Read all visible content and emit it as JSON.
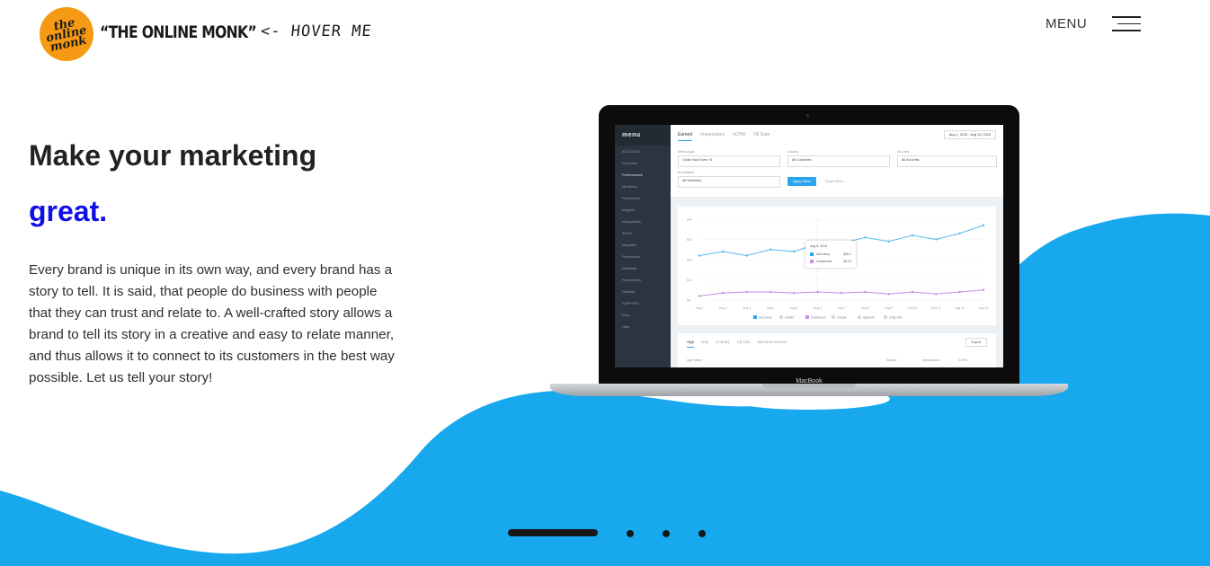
{
  "header": {
    "logo_text": "the\nonline\nmonk",
    "brand": "“THE ONLINE MONK”",
    "hover_hint": "<- HOVER ME",
    "menu_label": "MENU"
  },
  "hero": {
    "headline": "Make your marketing",
    "highlight": "great.",
    "description": "Every brand is unique in its own way, and every brand has a story to tell. It is said, that people do business with people that they can trust and relate to. A well-crafted story allows a brand to tell its story in a creative and easy to relate manner, and thus allows it to connect to its customers in the best way possible. Let us tell your story!"
  },
  "colors": {
    "accent_blue": "#1010e6",
    "wave_blue": "#17a8ee",
    "line_blue": "#5ab8ef",
    "line_purple": "#c48ee8"
  },
  "laptop": {
    "brand_label": "MacBook",
    "sidebar": {
      "title": "menu",
      "items": [
        "ACCOUNT",
        "Overview",
        "Performance",
        "Mediation",
        "Promotions",
        "Insights",
        "Integrations",
        "APPS",
        "Magnetic",
        "Promotions",
        "Materials",
        "Placements",
        "Settings",
        "SUPPORT",
        "Docs",
        "Help"
      ]
    },
    "tabs": [
      "Earned",
      "Impressions",
      "eCPM",
      "Fill Rate"
    ],
    "date_range": "Aug 1, 2016 - Aug 15, 2016",
    "filters": {
      "select_apps_label": "Select Apps",
      "select_apps_value": "Close Your Eyes +3",
      "country_label": "Country",
      "country_value": "All Countries",
      "ad_units_label": "Ad Units",
      "ad_units_value": "All Ad Units",
      "ad_network_label": "Ad Network",
      "ad_network_value": "All Networks",
      "apply_label": "Apply Filters",
      "reset_label": "Reset Filters"
    },
    "tooltip": {
      "date": "Aug 8, 2016",
      "rows": [
        {
          "name": "AdColony",
          "value": "$28.1"
        },
        {
          "name": "Chartboost",
          "value": "$3.24"
        }
      ]
    },
    "table": {
      "tabs": [
        "App",
        "Day",
        "Country",
        "Ad Unit",
        "Demand Source"
      ],
      "export_label": "Export",
      "headers": [
        "App Name",
        "Earned",
        "Impressions",
        "eCPM"
      ]
    }
  },
  "chart_data": {
    "type": "line",
    "title": "",
    "x": [
      "Aug 1",
      "Aug 2",
      "Aug 3",
      "Aug 4",
      "Aug 5",
      "Aug 6",
      "Aug 7",
      "Aug 8",
      "Aug 9",
      "Aug 10",
      "Aug 11",
      "Aug 12",
      "Aug 13"
    ],
    "y_ticks": [
      "$40",
      "$30",
      "$20",
      "$10",
      "$0"
    ],
    "ylim": [
      0,
      40
    ],
    "series": [
      {
        "name": "AdColony",
        "color": "#5ab8ef",
        "values": [
          22,
          24,
          22,
          25,
          24,
          28,
          28,
          31,
          29,
          32,
          30,
          33,
          37
        ]
      },
      {
        "name": "Chartboost",
        "color": "#c48ee8",
        "values": [
          2,
          3.5,
          4,
          4,
          3.5,
          4,
          3.5,
          4,
          3,
          4,
          3,
          4,
          5
        ]
      }
    ],
    "legend": [
      "AdColony",
      "InMobi",
      "Chartboost",
      "Vdopia",
      "Applovin",
      "Unity Ads"
    ],
    "legend_position": "bottom",
    "grid": true
  },
  "pager": {
    "pages": 4,
    "active": 1
  }
}
